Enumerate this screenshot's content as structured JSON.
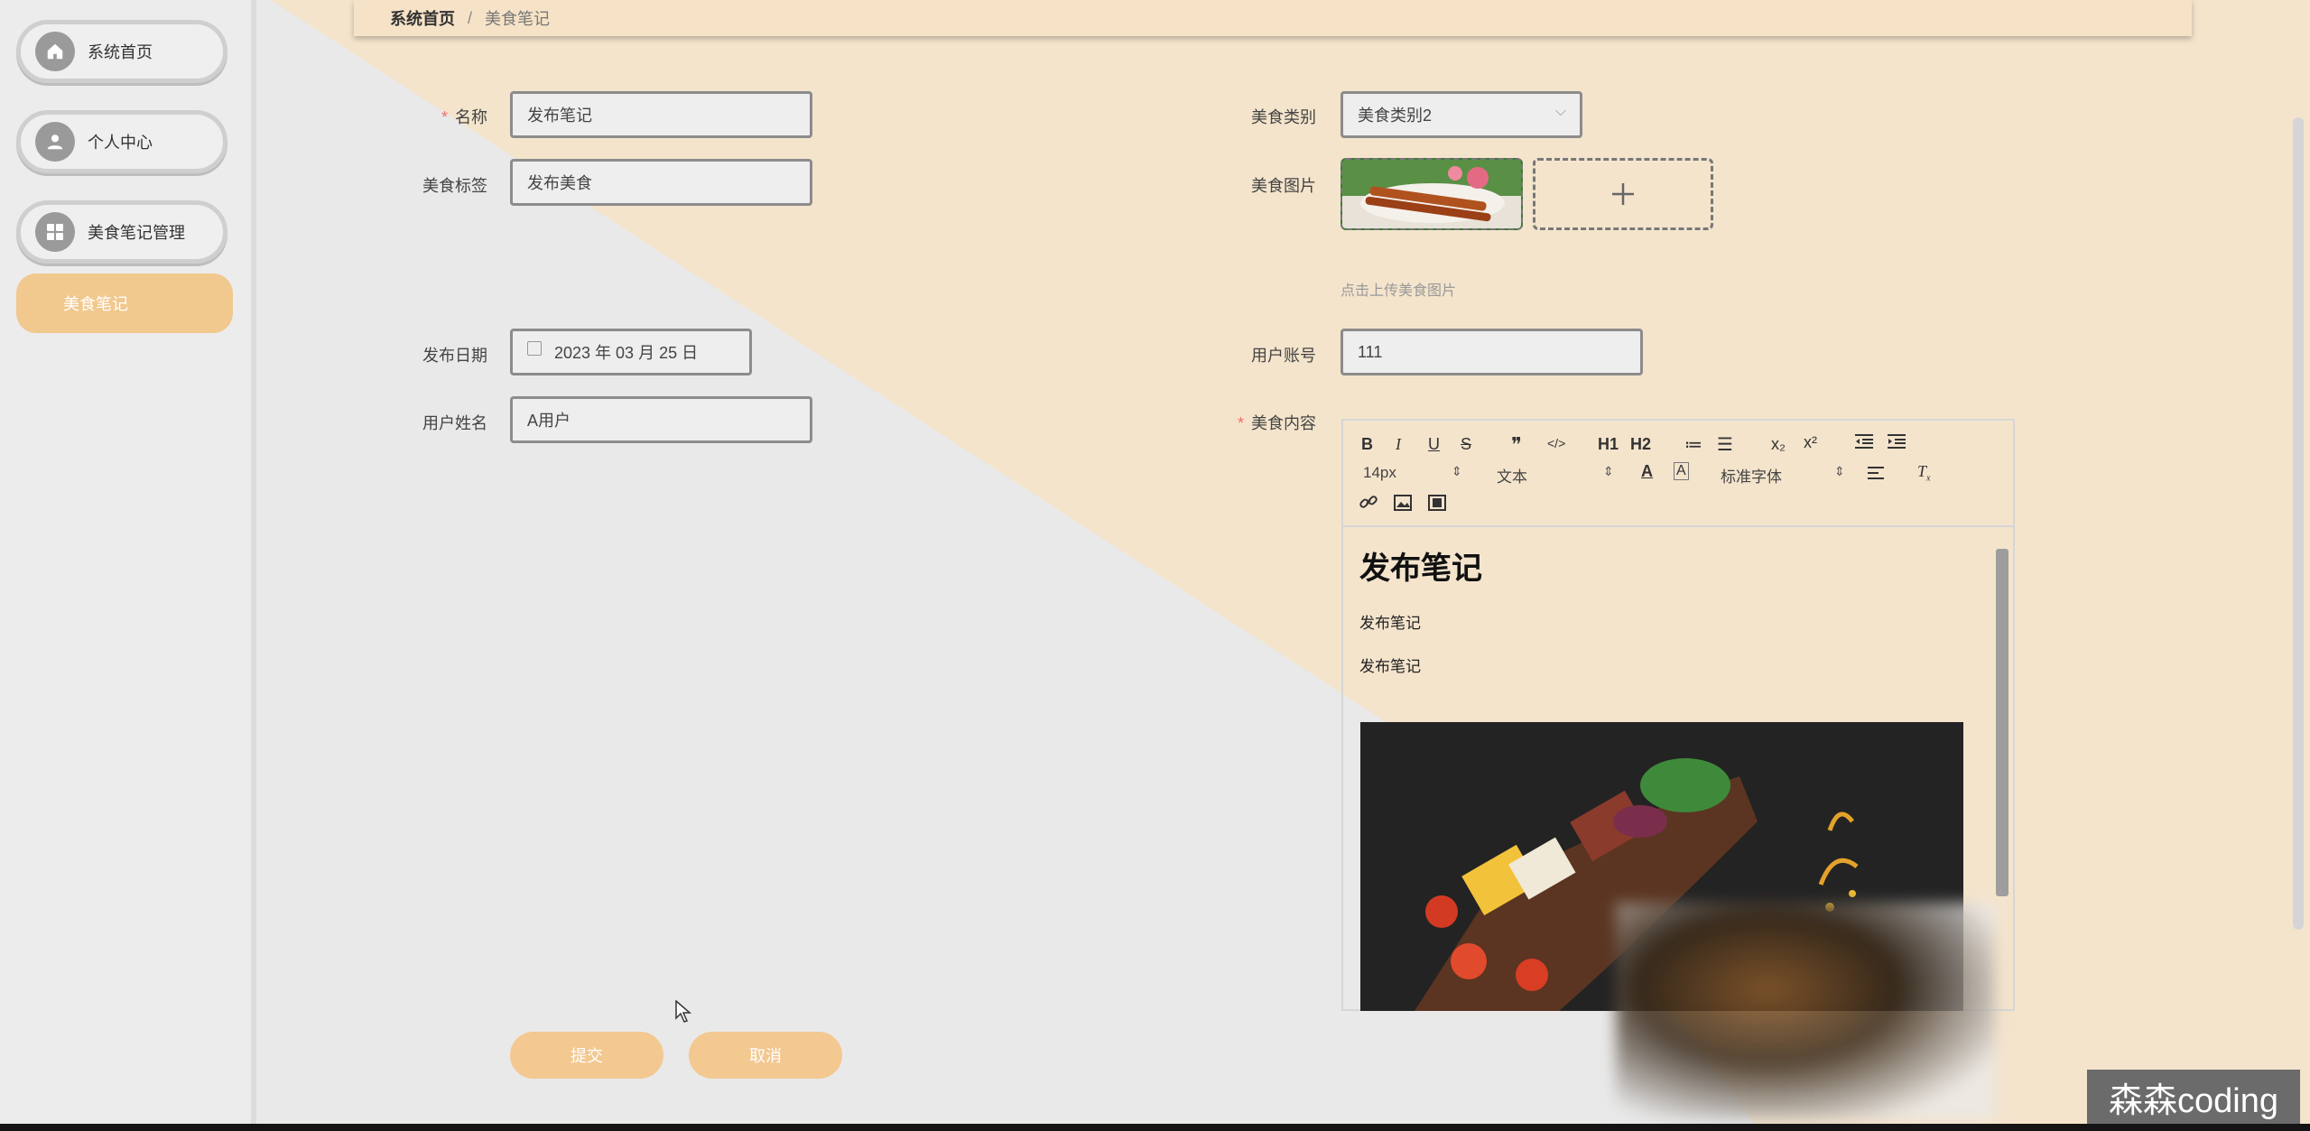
{
  "sidebar": {
    "items": [
      {
        "label": "系统首页",
        "icon": "home-icon"
      },
      {
        "label": "个人中心",
        "icon": "user-icon"
      },
      {
        "label": "美食笔记管理",
        "icon": "grid-icon"
      }
    ],
    "sub_item": "美食笔记"
  },
  "breadcrumb": {
    "home": "系统首页",
    "separator": "/",
    "current": "美食笔记"
  },
  "form": {
    "name": {
      "label": "名称",
      "value": "发布笔记"
    },
    "tag": {
      "label": "美食标签",
      "value": "发布美食"
    },
    "date": {
      "label": "发布日期",
      "value": "2023 年 03 月 25 日"
    },
    "username": {
      "label": "用户姓名",
      "value": "A用户"
    },
    "category": {
      "label": "美食类别",
      "value": "美食类别2"
    },
    "image": {
      "label": "美食图片",
      "hint": "点击上传美食图片"
    },
    "account": {
      "label": "用户账号",
      "value": "111"
    },
    "content": {
      "label": "美食内容"
    }
  },
  "editor": {
    "buttons": [
      "B",
      "I",
      "U",
      "S",
      "❞",
      "</>",
      "H1",
      "H2",
      "≔",
      "☰",
      "x₂",
      "x²"
    ],
    "font_size": "14px",
    "paragraph": "文本",
    "font_family": "标准字体",
    "heading": "发布笔记",
    "paragraphs": [
      "发布笔记",
      "发布笔记"
    ]
  },
  "actions": {
    "submit": "提交",
    "cancel": "取消"
  },
  "watermark": "森森coding",
  "colors": {
    "accent": "#f1c88d",
    "wedge": "#f4e4cc",
    "required": "#f56c6c"
  }
}
